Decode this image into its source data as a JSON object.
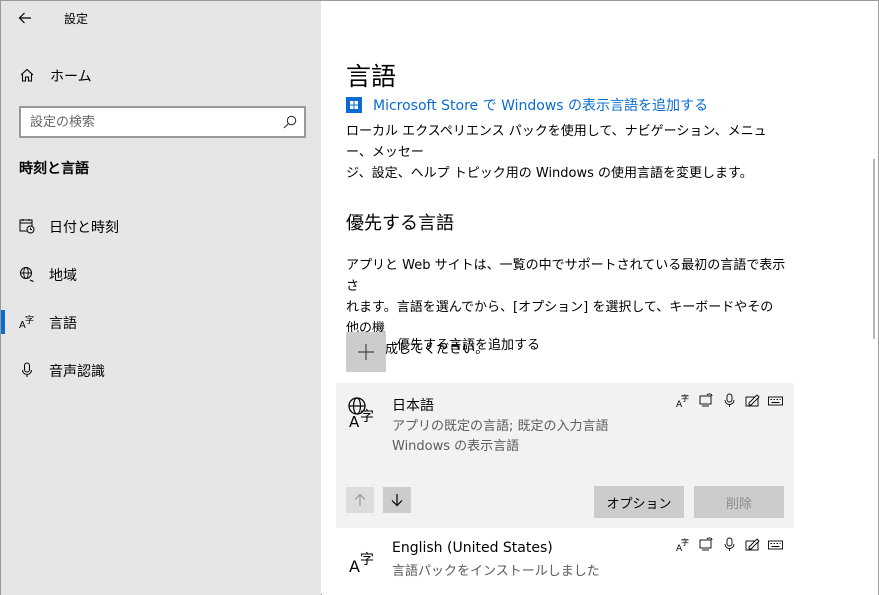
{
  "window": {
    "title": "設定",
    "controls": [
      "minimize",
      "maximize",
      "close"
    ]
  },
  "sidebar": {
    "home_label": "ホーム",
    "search_placeholder": "設定の検索",
    "section_title": "時刻と言語",
    "items": [
      {
        "label": "日付と時刻",
        "icon": "calendar-clock-icon",
        "selected": false
      },
      {
        "label": "地域",
        "icon": "globe-pin-icon",
        "selected": false
      },
      {
        "label": "言語",
        "icon": "language-icon",
        "selected": true
      },
      {
        "label": "音声認識",
        "icon": "microphone-icon",
        "selected": false
      }
    ]
  },
  "main": {
    "title": "言語",
    "store_link": "Microsoft Store で Windows の表示言語を追加する",
    "store_desc": [
      "ローカル エクスペリエンス パックを使用して、ナビゲーション、メニュー、メッセー",
      "ジ、設定、ヘルプ トピック用の Windows の使用言語を変更します。"
    ],
    "preferred_heading": "優先する言語",
    "preferred_desc": [
      "アプリと Web サイトは、一覧の中でサポートされている最初の言語で表示さ",
      "れます。言語を選んでから、[オプション] を選択して、キーボードやその他の機",
      "能を構成してください。"
    ],
    "add_language_label": "優先する言語を追加する",
    "languages": [
      {
        "name": "日本語",
        "details": [
          "アプリの既定の言語; 既定の入力言語",
          "Windows の表示言語"
        ],
        "options_label": "オプション",
        "remove_label": "削除"
      },
      {
        "name": "English (United States)",
        "details": [
          "言語パックをインストールしました"
        ]
      }
    ]
  },
  "colors": {
    "accent": "#0a6cd1",
    "sidebar_bg": "#e6e6e6",
    "card_bg": "#f2f2f2",
    "button_bg": "#cccccc"
  }
}
